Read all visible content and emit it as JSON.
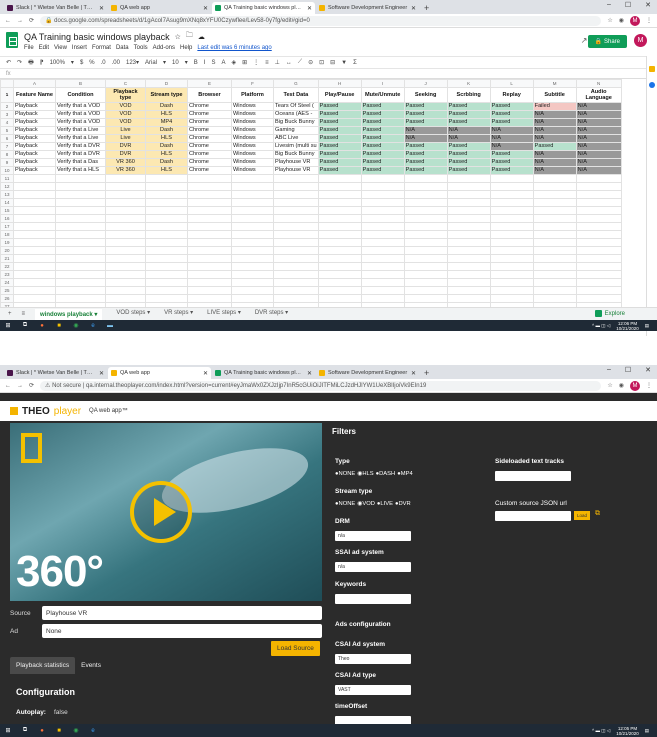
{
  "top_browser": {
    "tabs": [
      {
        "title": "Slack | * Wietse Van Belle | THEO",
        "color": "#4a154b",
        "active": false
      },
      {
        "title": "QA web app",
        "color": "#f4b400",
        "active": false
      },
      {
        "title": "QA Training basic windows playb",
        "color": "#0f9d58",
        "active": true
      },
      {
        "title": "Software Development Engineer",
        "color": "#f4b400",
        "active": false
      }
    ],
    "url": "docs.google.com/spreadsheets/d/1gAcoI7Asug9mXNq8xYFU0Czywflee/Lev58-0y7fg/edit#gid=0",
    "win_controls": [
      "–",
      "☐",
      "✕"
    ]
  },
  "sheets": {
    "doc_title": "QA Training basic windows playback",
    "menus": [
      "File",
      "Edit",
      "View",
      "Insert",
      "Format",
      "Data",
      "Tools",
      "Add-ons",
      "Help"
    ],
    "last_edit": "Last edit was 6 minutes ago",
    "share_label": "Share",
    "avatar_letter": "M",
    "toolbar_items": [
      "↶",
      "↷",
      "🖶",
      "⁋",
      "100%",
      "▾",
      "$",
      "%",
      ".0",
      ".00",
      "123▾",
      "Arial",
      "▾",
      "10",
      "▾",
      "B",
      "I",
      "S",
      "A",
      "◈",
      "⊞",
      "⋮",
      "≡",
      "⊥",
      "↔",
      "⟋",
      "⊝",
      "⊡",
      "⊟",
      "▼",
      "Σ"
    ],
    "fx": "fx",
    "col_letters": [
      "A",
      "B",
      "C",
      "D",
      "E",
      "F",
      "G",
      "H",
      "I",
      "J",
      "K",
      "L",
      "M",
      "N"
    ],
    "headers": [
      "Feature Name",
      "Condition",
      "Playback type",
      "Stream type",
      "Browser",
      "Platform",
      "Test Data",
      "Play/Pause",
      "Mute/Unmute",
      "Seeking",
      "Scrbbing",
      "Replay",
      "Subtitle",
      "Audio Language"
    ],
    "rows": [
      [
        "Playback",
        "Verify that a VOD",
        "VOD",
        "Dash",
        "Chrome",
        "Windows",
        "Tears Of Steel (",
        "Passed",
        "Passed",
        "Passed",
        "Passed",
        "Passed",
        "Failed",
        "N/A"
      ],
      [
        "Playback",
        "Verify that a VOD",
        "VOD",
        "HLS",
        "Chrome",
        "Windows",
        "Oceans (AES -",
        "Passed",
        "Passed",
        "Passed",
        "Passed",
        "Passed",
        "N/A",
        "N/A"
      ],
      [
        "Playback",
        "Verify that a VOD",
        "VOD",
        "MP4",
        "Chrome",
        "Windows",
        "Big Buck Bunny",
        "Passed",
        "Passed",
        "Passed",
        "Passed",
        "Passed",
        "N/A",
        "N/A"
      ],
      [
        "Playback",
        "Verify that a Live",
        "Live",
        "Dash",
        "Chrome",
        "Windows",
        "Gaming",
        "Passed",
        "Passed",
        "N/A",
        "N/A",
        "N/A",
        "N/A",
        "N/A"
      ],
      [
        "Playback",
        "Verify that a Live",
        "Live",
        "HLS",
        "Chrome",
        "Windows",
        "ABC Live",
        "Passed",
        "Passed",
        "N/A",
        "N/A",
        "N/A",
        "N/A",
        "N/A"
      ],
      [
        "Playback",
        "Verify that a DVR",
        "DVR",
        "Dash",
        "Chrome",
        "Windows",
        "Livesim (multi su",
        "Passed",
        "Passed",
        "Passed",
        "Passed",
        "N/A",
        "Passed",
        "N/A"
      ],
      [
        "Playback",
        "Verify that a DVR",
        "DVR",
        "HLS",
        "Chrome",
        "Windows",
        "Big Buck Bunny",
        "Passed",
        "Passed",
        "Passed",
        "Passed",
        "Passed",
        "N/A",
        "N/A"
      ],
      [
        "Playback",
        "Verify that a Das",
        "VR 360",
        "Dash",
        "Chrome",
        "Windows",
        "Playhouse VR",
        "Passed",
        "Passed",
        "Passed",
        "Passed",
        "Passed",
        "N/A",
        "N/A"
      ],
      [
        "Playback",
        "Verify that a HLS",
        "VR 360",
        "HLS",
        "Chrome",
        "Windows",
        "Playhouse VR",
        "Passed",
        "Passed",
        "Passed",
        "Passed",
        "Passed",
        "N/A",
        "N/A"
      ]
    ],
    "empty_row_numbers": [
      11,
      12,
      13,
      14,
      15,
      16,
      17,
      18,
      19,
      20,
      21,
      22,
      23,
      24,
      25,
      26,
      27,
      28,
      29,
      30,
      31,
      32,
      33,
      34,
      35
    ],
    "sheet_tabs": [
      "windows playback ▾",
      "VOD steps ▾",
      "VR steps ▾",
      "LIVE steps ▾",
      "DVR steps ▾"
    ],
    "explore_label": "Explore",
    "colors": {
      "passed": "#b7e1cd",
      "failed": "#f4c7c3",
      "na": "#999999",
      "playback": "#fce8b2"
    }
  },
  "taskbar1": {
    "time": "12:06 PM",
    "date": "10/21/2020"
  },
  "bottom_browser": {
    "tabs": [
      {
        "title": "Slack | * Wietse Van Belle | THEO",
        "color": "#4a154b",
        "active": false
      },
      {
        "title": "QA web app",
        "color": "#f4b400",
        "active": true
      },
      {
        "title": "QA Training basic windows playb",
        "color": "#0f9d58",
        "active": false
      },
      {
        "title": "Software Development Engineer",
        "color": "#f4b400",
        "active": false
      }
    ],
    "not_secure": "Not secure",
    "url": "qa.internal.theoplayer.com/index.html?version=current#eyJmaWx0ZXJzIjp7InR5cGUiOiJITFMiLCJzdHJlYW1UeXBlIjoiVk9EIn19"
  },
  "theo": {
    "logo_theo": "THEO",
    "logo_player": "player",
    "app_title": "QA web app™",
    "player_text": "360°",
    "source_label": "Source",
    "source_value": "Playhouse VR",
    "ad_label": "Ad",
    "ad_value": "None",
    "load_source": "Load Source",
    "tabs": [
      "Playback statistics",
      "Events"
    ],
    "config_title": "Configuration",
    "autoplay_label": "Autoplay:",
    "autoplay_value": "false",
    "filters_title": "Filters",
    "type_label": "Type",
    "type_options": [
      "NONE",
      "HLS",
      "DASH",
      "MP4"
    ],
    "stream_type_label": "Stream type",
    "stream_options": [
      "NONE",
      "VOD",
      "LIVE",
      "DVR"
    ],
    "drm_label": "DRM",
    "drm_value": "n/a",
    "ssai_label": "SSAI ad system",
    "ssai_value": "n/a",
    "keywords_label": "Keywords",
    "ads_config_label": "Ads configuration",
    "csai_system_label": "CSAI Ad system",
    "csai_system_value": "Theo",
    "csai_type_label": "CSAI Ad type",
    "csai_type_value": "VAST",
    "time_offset_label": "timeOffset",
    "sideloaded_label": "Sideloaded text tracks",
    "custom_json_label": "Custom source JSON url",
    "load_label": "Load"
  },
  "taskbar2": {
    "time": "12:05 PM",
    "date": "10/21/2020"
  }
}
